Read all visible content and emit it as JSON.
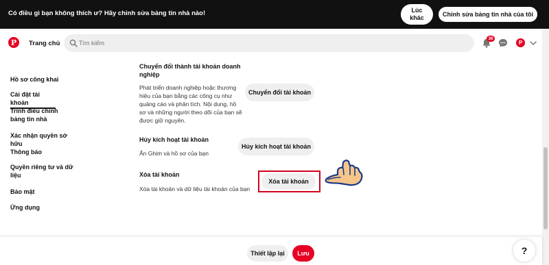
{
  "banner": {
    "message": "Có điều gì bạn không thích ư? Hãy chỉnh sửa bảng tin nhà nào!",
    "later_label": "Lúc khác",
    "edit_feed_label": "Chỉnh sửa bảng tin nhà của tôi"
  },
  "header": {
    "logo": "P",
    "home_label": "Trang chủ",
    "search_placeholder": "Tìm kiếm",
    "notifications_count": "38",
    "avatar_initial": "P"
  },
  "sidebar": {
    "items": [
      {
        "label": "Hồ sơ công khai"
      },
      {
        "label": "Cài đặt tài khoản"
      },
      {
        "label": "Trình điều chỉnh bảng tin nhà"
      },
      {
        "label": "Xác nhận quyền sở hữu"
      },
      {
        "label": "Thông báo"
      },
      {
        "label": "Quyền riêng tư và dữ liệu"
      },
      {
        "label": "Bảo mật"
      },
      {
        "label": "Ứng dụng"
      }
    ],
    "active_index": 1
  },
  "sections": {
    "convert": {
      "title": "Chuyển đổi thành tài khoản doanh nghiệp",
      "description": "Phát triển doanh nghiệp hoặc thương hiệu của bạn bằng các công cụ như quảng cáo và phân tích. Nội dung, hồ sơ và những người theo dõi của bạn sẽ được giữ nguyên.",
      "button_label": "Chuyển đổi tài khoản"
    },
    "deactivate": {
      "title": "Hủy kích hoạt tài khoản",
      "description": "Ẩn Ghim và hồ sơ của bạn",
      "button_label": "Hủy kích hoạt tài khoản"
    },
    "delete": {
      "title": "Xóa tài khoản",
      "description": "Xóa tài khoản và dữ liệu tài khoản của bạn",
      "button_label": "Xóa tài khoản"
    }
  },
  "footer": {
    "reset_label": "Thiết lập lại",
    "save_label": "Lưu",
    "help_label": "?"
  },
  "colors": {
    "brand": "#e60023",
    "highlight": "#d0021b",
    "banner_bg": "#111111"
  }
}
